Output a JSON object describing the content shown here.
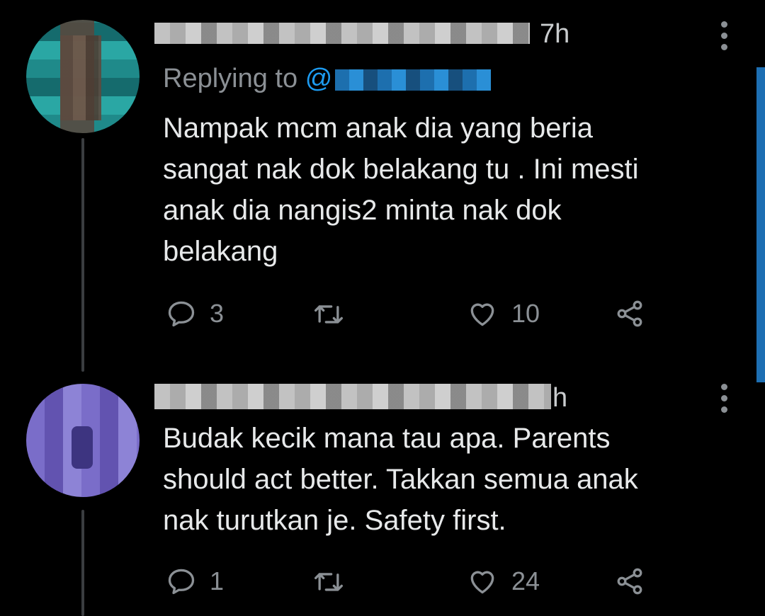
{
  "tweets": [
    {
      "time": "7h",
      "replying_prefix": "Replying to",
      "replying_handle": "@",
      "body_lines": [
        "Nampak mcm anak dia yang beria",
        "sangat nak dok belakang tu . Ini mesti",
        "anak dia nangis2 minta nak dok",
        "belakang"
      ],
      "replies": "3",
      "retweets": "",
      "likes": "10"
    },
    {
      "time": "h",
      "body_lines": [
        "Budak kecik mana tau apa. Parents",
        "should act better. Takkan semua anak",
        "nak turutkan je. Safety first."
      ],
      "replies": "1",
      "retweets": "",
      "likes": "24"
    }
  ],
  "icons": {
    "reply": "reply-icon",
    "retweet": "retweet-icon",
    "like": "heart-icon",
    "share": "share-icon",
    "menu": "more-vertical-icon"
  },
  "colors": {
    "background": "#000000",
    "text": "#e7e9ea",
    "muted": "#8b9095",
    "accent": "#1d9bf0"
  }
}
